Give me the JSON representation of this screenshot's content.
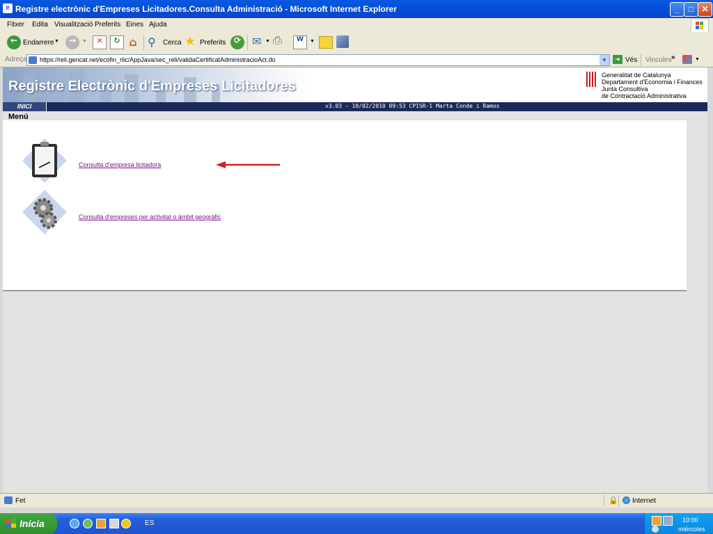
{
  "window": {
    "title": "Registre electrònic d'Empreses Licitadores.Consulta Administració - Microsoft Internet Explorer",
    "icon": "ie-page-icon",
    "minimize": "_",
    "maximize": "□",
    "close": "✕"
  },
  "menubar": {
    "items": [
      "Fitxer",
      "Edita",
      "Visualització",
      "Preferits",
      "Eines",
      "Ajuda"
    ]
  },
  "toolbar": {
    "back_label": "Endarrere",
    "search_label": "Cerca",
    "favorites_label": "Preferits"
  },
  "addressbar": {
    "label": "Adreça",
    "url": "https://reli.gencat.net/ecofin_rlic/AppJava/sec_reli/validaCertificatAdministracioAct.do",
    "go_label": "Vés",
    "links_label": "Vincules"
  },
  "banner": {
    "site_title": "Registre Electrònic d'Empreses Licitadores",
    "org_lines": [
      "Generalitat de Catalunya",
      "Departament d'Economia i Finances",
      "Junta Consultiva",
      "de Contractació Administrativa"
    ]
  },
  "nav": {
    "tab": "INICI",
    "version": "v3.03 - 10/02/2010 09:53 CPISR-1 Marta Conde i Ramos"
  },
  "menu": {
    "title": "Menú",
    "items": [
      {
        "label": "Consulta d'empresa licitadora",
        "icon": "clipboard-icon"
      },
      {
        "label": "Consulta d'empreses per activitat o àmbit geogràfic",
        "icon": "gears-icon"
      }
    ]
  },
  "annotation": {
    "arrow_color": "#d81e1e"
  },
  "statusbar": {
    "status": "Fet",
    "zone": "Internet"
  },
  "taskbar": {
    "start_label": "Inicia",
    "lang": "ES",
    "clock": "10:00",
    "day": "miércoles"
  }
}
